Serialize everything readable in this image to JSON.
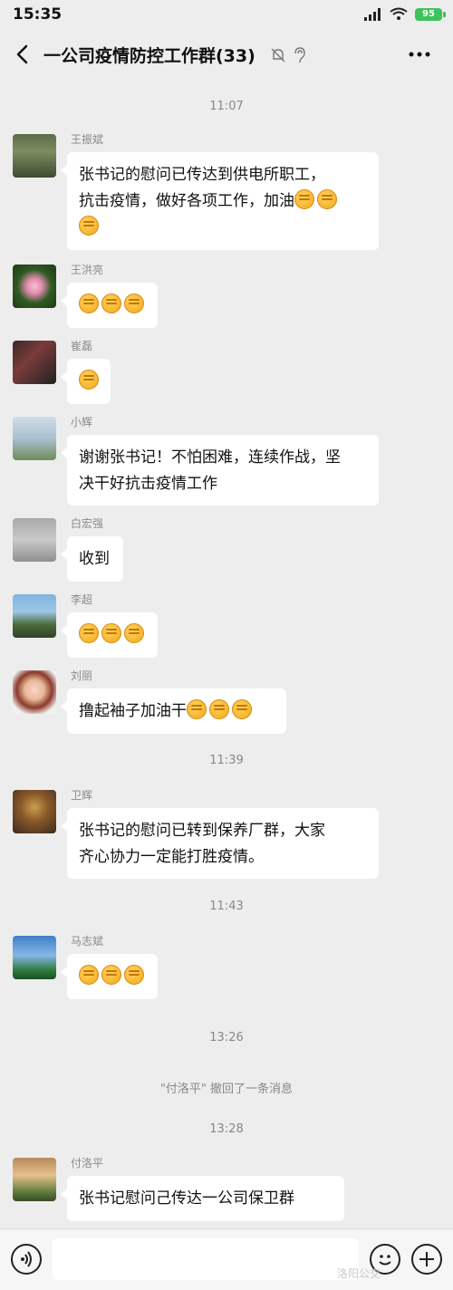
{
  "status_bar": {
    "time": "15:35",
    "battery": "95"
  },
  "header": {
    "title": "一公司疫情防控工作群(33)"
  },
  "timestamps": [
    "11:07",
    "11:39",
    "11:43",
    "13:26",
    "13:28"
  ],
  "system_message": "\"付洛平\" 撤回了一条消息",
  "messages": [
    {
      "sender": "王振斌",
      "line1": "张书记的慰问已传达到供电所职工，",
      "line2": "抗击疫情，做好各项工作，加油",
      "fists_inline": 2,
      "fists_line3": 1
    },
    {
      "sender": "王洪亮",
      "fists": 3
    },
    {
      "sender": "崔磊",
      "fists": 1
    },
    {
      "sender": "小辉",
      "line1": "谢谢张书记！不怕困难，连续作战，坚",
      "line2": "决干好抗击疫情工作"
    },
    {
      "sender": "白宏强",
      "line1": "收到"
    },
    {
      "sender": "李超",
      "fists": 3
    },
    {
      "sender": "刘丽",
      "line1": "撸起袖子加油干",
      "fists_inline": 3
    },
    {
      "sender": "卫辉",
      "line1": "张书记的慰问已转到保养厂群，大家",
      "line2": "齐心协力一定能打胜疫情。"
    },
    {
      "sender": "马志斌",
      "fists": 3
    },
    {
      "sender": "付洛平",
      "line1": "张书记慰问己传达一公司保卫群"
    }
  ],
  "watermark": "洛阳公交",
  "colors": {
    "background": "#ededed",
    "bubble": "#ffffff",
    "battery": "#3cc35a"
  }
}
